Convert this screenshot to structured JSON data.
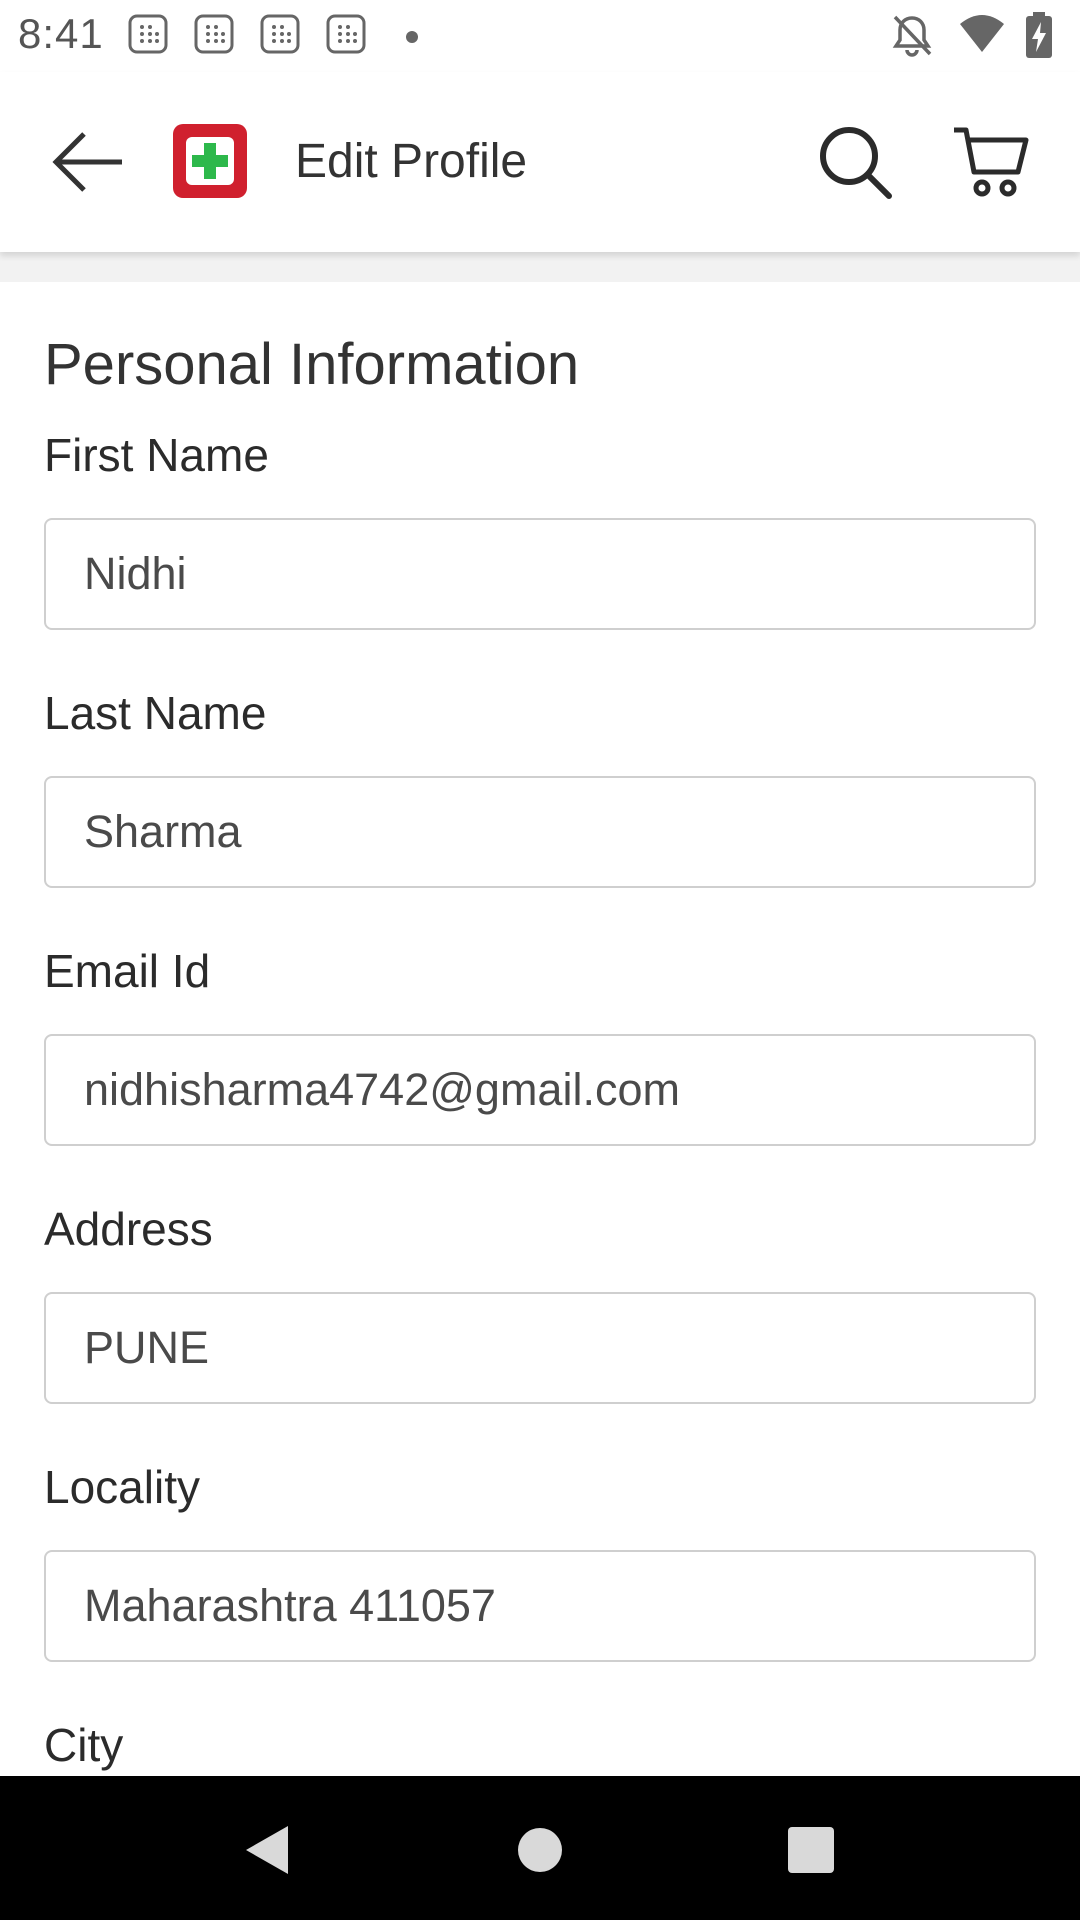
{
  "status_bar": {
    "time": "8:41",
    "notification_icons": [
      "calendar-grid-icon",
      "calendar-grid-icon",
      "calendar-grid-icon",
      "calendar-grid-icon"
    ],
    "right_icons": [
      "bell-off-icon",
      "wifi-icon",
      "battery-charging-icon"
    ]
  },
  "app_bar": {
    "title": "Edit Profile",
    "brand_color": "#d0202e",
    "logo_cross_color": "#2db84b"
  },
  "section": {
    "title": "Personal Information"
  },
  "fields": [
    {
      "label": "First Name",
      "value": "Nidhi"
    },
    {
      "label": "Last Name",
      "value": "Sharma"
    },
    {
      "label": "Email Id",
      "value": "nidhisharma4742@gmail.com"
    },
    {
      "label": "Address",
      "value": "PUNE"
    },
    {
      "label": "Locality",
      "value": "Maharashtra 411057"
    },
    {
      "label": "City",
      "value": ""
    }
  ],
  "nav_bar": {
    "buttons": [
      "back-triangle-icon",
      "home-circle-icon",
      "recents-square-icon"
    ]
  }
}
